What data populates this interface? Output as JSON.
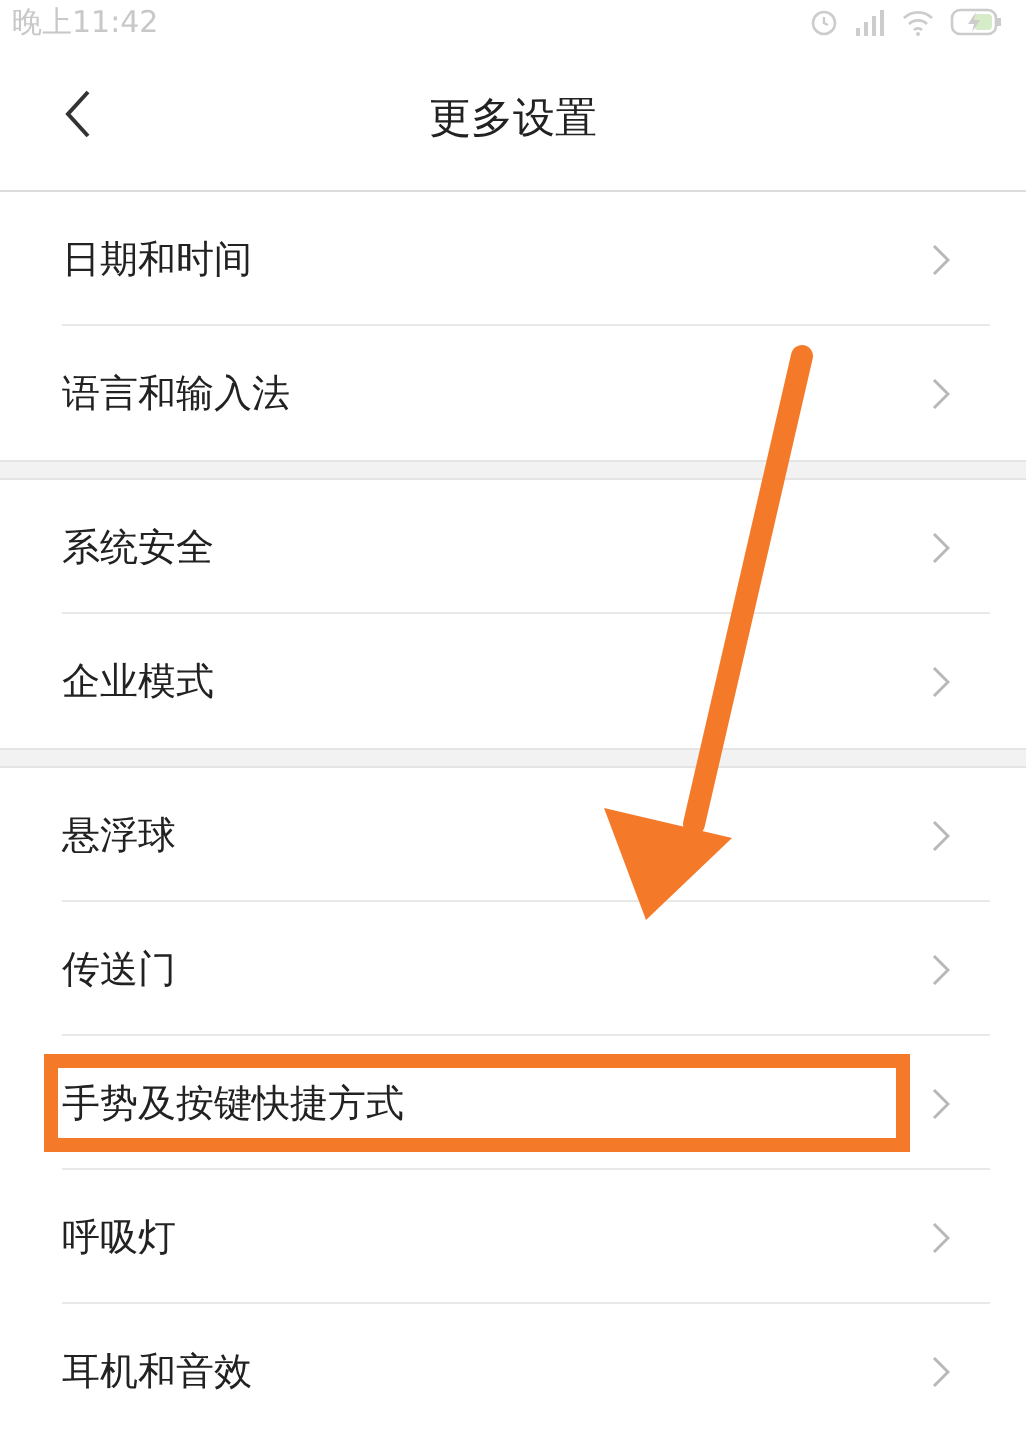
{
  "status_bar": {
    "time": "晚上11:42"
  },
  "header": {
    "title": "更多设置"
  },
  "groups": [
    {
      "items": [
        {
          "label": "日期和时间",
          "highlighted": false
        },
        {
          "label": "语言和输入法",
          "highlighted": false
        }
      ]
    },
    {
      "items": [
        {
          "label": "系统安全",
          "highlighted": false
        },
        {
          "label": "企业模式",
          "highlighted": false
        }
      ]
    },
    {
      "items": [
        {
          "label": "悬浮球",
          "highlighted": false
        },
        {
          "label": "传送门",
          "highlighted": false
        },
        {
          "label": "手势及按键快捷方式",
          "highlighted": true
        },
        {
          "label": "呼吸灯",
          "highlighted": false
        },
        {
          "label": "耳机和音效",
          "highlighted": false
        }
      ]
    }
  ]
}
